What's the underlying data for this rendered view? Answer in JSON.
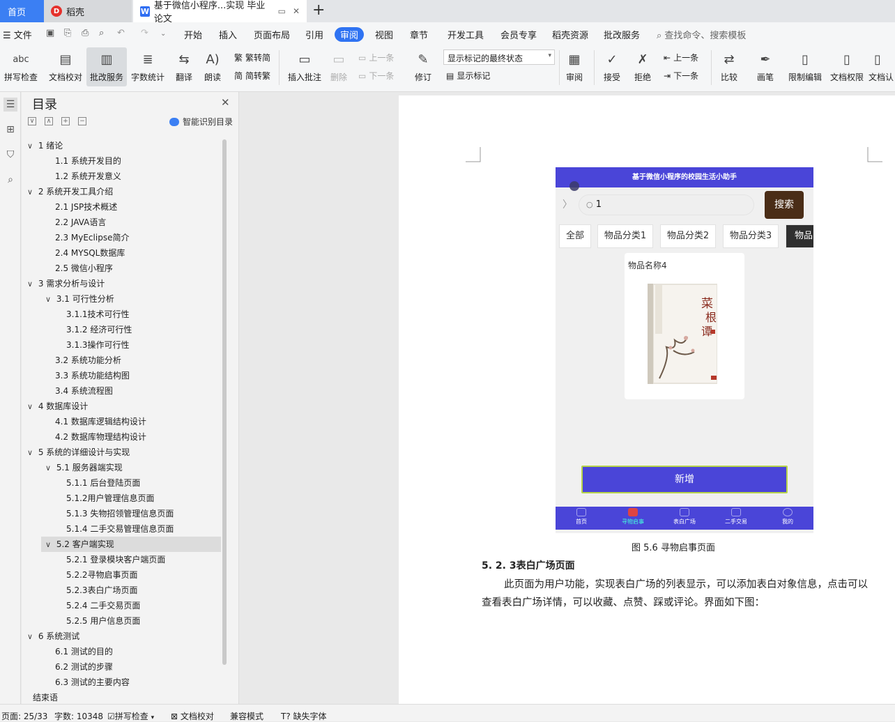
{
  "titlebar": {
    "tabs": [
      {
        "label": "首页"
      },
      {
        "label": "稻壳"
      },
      {
        "label": "基于微信小程序...实现 毕业论文"
      }
    ],
    "add_tab": "+"
  },
  "menubar": {
    "file": "文件",
    "items": [
      "开始",
      "插入",
      "页面布局",
      "引用",
      "审阅",
      "视图",
      "章节",
      "开发工具",
      "会员专享",
      "稻壳资源",
      "批改服务"
    ],
    "search": "查找命令、搜索模板"
  },
  "ribbon": {
    "spellcheck": "拼写检查",
    "proofread": "文档校对",
    "grading": "批改服务",
    "wordcount": "字数统计",
    "translate": "翻译",
    "readaloud": "朗读",
    "trad_conv": "繁转简",
    "simp_conv": "简转繁",
    "insert_comment": "插入批注",
    "delete": "删除",
    "prev_comment": "上一条",
    "next_comment": "下一条",
    "track": "修订",
    "markup_mode": "显示标记的最终状态",
    "show_markup": "显示标记",
    "review_pane": "审阅",
    "accept": "接受",
    "reject": "拒绝",
    "prev_change": "上一条",
    "next_change": "下一条",
    "compare": "比较",
    "pen": "画笔",
    "restrict": "限制编辑",
    "permission": "文档权限",
    "certify": "文档认"
  },
  "toc": {
    "title": "目录",
    "smart": "智能识别目录",
    "items": [
      {
        "text": "1  绪论",
        "level": 0,
        "chev": "∨"
      },
      {
        "text": "1.1  系统开发目的",
        "level": 1
      },
      {
        "text": "1.2  系统开发意义",
        "level": 1
      },
      {
        "text": "2  系统开发工具介绍",
        "level": 0,
        "chev": "∨"
      },
      {
        "text": "2.1 JSP技术概述",
        "level": 1
      },
      {
        "text": "2.2 JAVA语言",
        "level": 1
      },
      {
        "text": "2.3 MyEclipse简介",
        "level": 1
      },
      {
        "text": "2.4 MYSQL数据库",
        "level": 1
      },
      {
        "text": "2.5  微信小程序",
        "level": 1
      },
      {
        "text": "3  需求分析与设计",
        "level": 0,
        "chev": "∨"
      },
      {
        "text": "3.1  可行性分析",
        "level": 1,
        "chev": "∨"
      },
      {
        "text": "3.1.1技术可行性",
        "level": 2
      },
      {
        "text": "3.1.2  经济可行性",
        "level": 2
      },
      {
        "text": "3.1.3操作可行性",
        "level": 2
      },
      {
        "text": "3.2  系统功能分析",
        "level": 1
      },
      {
        "text": "3.3  系统功能结构图",
        "level": 1
      },
      {
        "text": "3.4  系统流程图",
        "level": 1
      },
      {
        "text": "4  数据库设计",
        "level": 0,
        "chev": "∨"
      },
      {
        "text": "4.1  数据库逻辑结构设计",
        "level": 1
      },
      {
        "text": "4.2  数据库物理结构设计",
        "level": 1
      },
      {
        "text": "5  系统的详细设计与实现",
        "level": 0,
        "chev": "∨"
      },
      {
        "text": "5.1  服务器端实现",
        "level": 1,
        "chev": "∨"
      },
      {
        "text": "5.1.1  后台登陆页面",
        "level": 2
      },
      {
        "text": "5.1.2用户管理信息页面",
        "level": 2
      },
      {
        "text": "5.1.3  失物招领管理信息页面",
        "level": 2
      },
      {
        "text": "5.1.4  二手交易管理信息页面",
        "level": 2
      },
      {
        "text": "5.2  客户端实现",
        "level": 1,
        "chev": "∨",
        "selected": true
      },
      {
        "text": "5.2.1  登录模块客户端页面",
        "level": 2
      },
      {
        "text": "5.2.2寻物启事页面",
        "level": 2
      },
      {
        "text": "5.2.3表白广场页面",
        "level": 2
      },
      {
        "text": "5.2.4  二手交易页面",
        "level": 2
      },
      {
        "text": "5.2.5  用户信息页面",
        "level": 2
      },
      {
        "text": "6  系统测试",
        "level": 0,
        "chev": "∨"
      },
      {
        "text": "6.1  测试的目的",
        "level": 1
      },
      {
        "text": "6.2  测试的步骤",
        "level": 1
      },
      {
        "text": "6.3  测试的主要内容",
        "level": 1
      },
      {
        "text": "结束语",
        "level": 0
      }
    ]
  },
  "phone": {
    "header": "基于微信小程序的校园生活小助手",
    "search_value": "1",
    "search_btn": "搜索",
    "categories": [
      "全部",
      "物品分类1",
      "物品分类2",
      "物品分类3",
      "物品"
    ],
    "card_name": "物品名称4",
    "book_title": "菜根谭",
    "add_btn": "新增",
    "nav": [
      "首页",
      "寻物启事",
      "表白广场",
      "二手交易",
      "我的"
    ]
  },
  "doc": {
    "caption": "图 5.6 寻物启事页面",
    "heading": "5. 2. 3表白广场页面",
    "paragraph": "此页面为用户功能，实现表白广场的列表显示，可以添加表白对象信息，点击可以查看表白广场详情，可以收藏、点赞、踩或评论。界面如下图："
  },
  "status": {
    "page": "页面: 25/33",
    "words": "字数: 10348",
    "spell": "拼写检查",
    "proof": "文档校对",
    "compat": "兼容模式",
    "missing_font": "缺失字体"
  },
  "colors": {
    "accent": "#3b7ff3",
    "phone_primary": "#4a45d8",
    "search_btn": "#4a2d17"
  }
}
